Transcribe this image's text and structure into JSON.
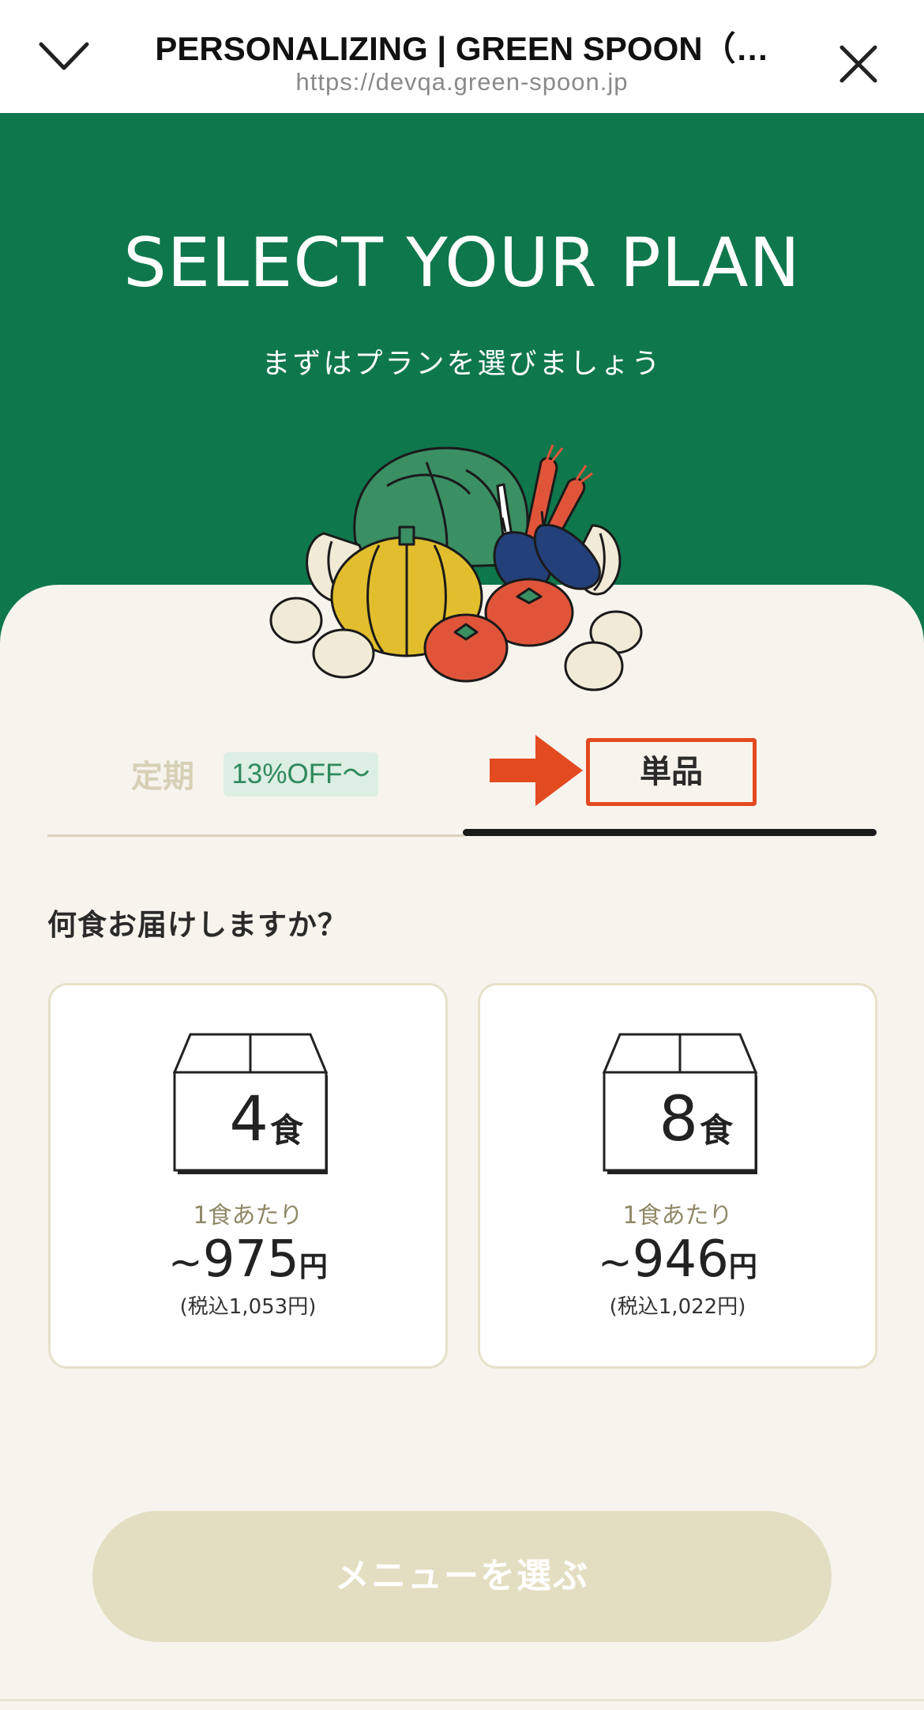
{
  "browser": {
    "title": "PERSONALIZING | GREEN SPOON（…",
    "url": "https://devqa.green-spoon.jp"
  },
  "hero": {
    "heading": "SELECT YOUR PLAN",
    "subheading": "まずはプランを選びましょう"
  },
  "tabs": {
    "subscription_label": "定期",
    "subscription_badge": "13%OFF〜",
    "single_label": "単品",
    "active": "single"
  },
  "question": "何食お届けしますか？",
  "plans": [
    {
      "count": "4",
      "unit": "食",
      "per_meal_label": "1食あたり",
      "tilde": "~",
      "price": "975",
      "yen": "円",
      "tax_included": "(税込1,053円)"
    },
    {
      "count": "8",
      "unit": "食",
      "per_meal_label": "1食あたり",
      "tilde": "~",
      "price": "946",
      "yen": "円",
      "tax_included": "(税込1,022円)"
    }
  ],
  "cta_label": "メニューを選ぶ",
  "colors": {
    "brand_green": "#0f774c",
    "cream": "#f7f4ee",
    "highlight_red": "#e34a20",
    "cta_disabled": "#e3dec1"
  },
  "icons": [
    "chevron-down-icon",
    "close-icon",
    "arrow-right-icon",
    "box-icon"
  ]
}
